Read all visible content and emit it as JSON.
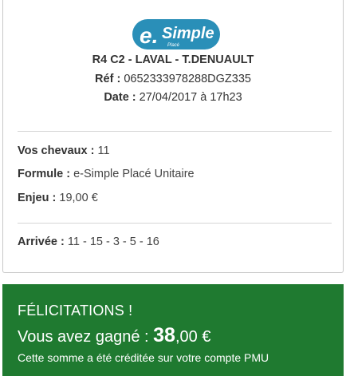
{
  "logo": {
    "main": "e.Simple",
    "sub": "Placé",
    "color": "#2a8fb8"
  },
  "race": {
    "title": "R4 C2 - LAVAL - T.DENUAULT",
    "ref_label": "Réf :",
    "ref_value": "0652333978288DGZ335",
    "date_label": "Date :",
    "date_value": "27/04/2017 à 17h23"
  },
  "bet": {
    "horses_label": "Vos chevaux :",
    "horses_value": "11",
    "formula_label": "Formule :",
    "formula_value": "e-Simple Placé Unitaire",
    "stake_label": "Enjeu :",
    "stake_value": "19,00 €"
  },
  "result": {
    "arrival_label": "Arrivée :",
    "arrival_value": "11 - 15 - 3 - 5 - 16"
  },
  "win": {
    "congrats": "FÉLICITATIONS !",
    "won_prefix": "Vous avez gagné : ",
    "amount_int": "38",
    "amount_rest": ",00 €",
    "note": "Cette somme a été créditée sur votre compte PMU",
    "bg_color": "#1f7a30"
  }
}
